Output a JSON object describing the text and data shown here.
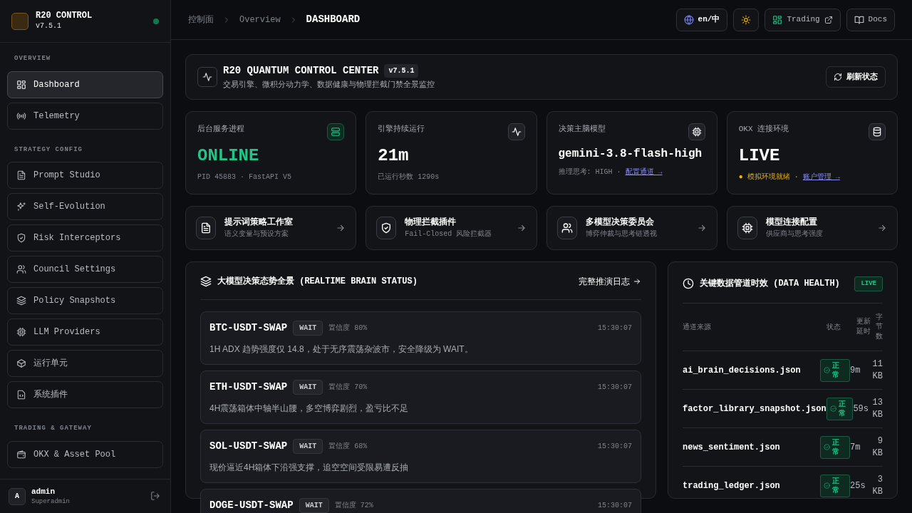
{
  "brand": {
    "title": "R20 CONTROL",
    "version": "v7.5.1",
    "online": true
  },
  "sidebar": {
    "sections": [
      {
        "heading": "OVERVIEW",
        "items": [
          {
            "label": "Dashboard",
            "selected": true
          },
          {
            "label": "Telemetry",
            "selected": false
          }
        ]
      },
      {
        "heading": "STRATEGY CONFIG",
        "items": [
          {
            "label": "Prompt Studio",
            "selected": false
          },
          {
            "label": "Self-Evolution",
            "selected": false
          },
          {
            "label": "Risk Interceptors",
            "selected": false
          },
          {
            "label": "Council Settings",
            "selected": false
          },
          {
            "label": "Policy Snapshots",
            "selected": false
          },
          {
            "label": "LLM Providers",
            "selected": false
          },
          {
            "label": "运行单元",
            "selected": false
          },
          {
            "label": "系统插件",
            "selected": false
          }
        ]
      },
      {
        "heading": "TRADING & GATEWAY",
        "items": [
          {
            "label": "OKX & Asset Pool",
            "selected": false
          }
        ]
      }
    ]
  },
  "user": {
    "avatar": "A",
    "name": "admin",
    "role": "Superadmin"
  },
  "breadcrumb": [
    "控制面",
    "Overview",
    "DASHBOARD"
  ],
  "toolbar": {
    "language": "en/中",
    "trading": "Trading",
    "docs": "Docs"
  },
  "hero": {
    "title": "R20 QUANTUM CONTROL CENTER",
    "version": "v7.5.1",
    "subtitle": "交易引擎、微积分动力学、数据健康与物理拦截门禁全景监控",
    "button": "刷新状态"
  },
  "stats": [
    {
      "label": "后台服务进程",
      "value": "ONLINE",
      "highlighted": true,
      "note": "PID 45883 · FastAPI V5"
    },
    {
      "label": "引擎持续运行",
      "value": "21m",
      "highlighted": false,
      "note": "已运行秒数 1290s"
    },
    {
      "label": "决策主脑模型",
      "value": "gemini-3.8-flash-high",
      "highlighted": false,
      "note": "推理思考: HIGH ·",
      "link": "配置通道 →"
    },
    {
      "label": "OKX 连接环境",
      "value": "LIVE",
      "highlighted": false,
      "status": "● 模拟环境就绪 ·",
      "link": "账户管理 →"
    }
  ],
  "shortcuts": [
    {
      "title": "提示词策略工作室",
      "subtitle": "语义变量与预设方案"
    },
    {
      "title": "物理拦截插件",
      "subtitle": "Fail-Closed 风险拦截器"
    },
    {
      "title": "多模型决策委员会",
      "subtitle": "博弈仲裁与思考链透视"
    },
    {
      "title": "模型连接配置",
      "subtitle": "供应商与思考强度"
    }
  ],
  "brain": {
    "title": "大模型决策态势全景 (REALTIME BRAIN STATUS)",
    "link": "完整推演日志",
    "decisions": [
      {
        "symbol": "BTC-USDT-SWAP",
        "action": "WAIT",
        "confidence": "置信度 80%",
        "time": "15:30:07",
        "reason": "1H ADX 趋势强度仅 14.8，处于无序震荡杂波市，安全降级为 WAIT。"
      },
      {
        "symbol": "ETH-USDT-SWAP",
        "action": "WAIT",
        "confidence": "置信度 70%",
        "time": "15:30:07",
        "reason": "4H震荡箱体中轴半山腰，多空博弈剧烈，盈亏比不足"
      },
      {
        "symbol": "SOL-USDT-SWAP",
        "action": "WAIT",
        "confidence": "置信度 68%",
        "time": "15:30:07",
        "reason": "现价逼近4H箱体下沿强支撑，追空空间受限易遭反抽"
      },
      {
        "symbol": "DOGE-USDT-SWAP",
        "action": "WAIT",
        "confidence": "置信度 72%",
        "time": "15:30:07"
      }
    ]
  },
  "health": {
    "title": "关键数据管道时效 (DATA HEALTH)",
    "badge": "LIVE",
    "columns": [
      "通道来源",
      "状态",
      "更新延时",
      "字节数"
    ],
    "rows": [
      {
        "source": "ai_brain_decisions.json",
        "status": "正常",
        "ok": true,
        "delay": "9m",
        "size": "11 KB"
      },
      {
        "source": "factor_library_snapshot.json",
        "status": "正常",
        "ok": true,
        "delay": "59s",
        "size": "13 KB"
      },
      {
        "source": "news_sentiment.json",
        "status": "正常",
        "ok": true,
        "delay": "7m",
        "size": "9 KB"
      },
      {
        "source": "trading_ledger.json",
        "status": "正常",
        "ok": true,
        "delay": "25s",
        "size": "3 KB"
      }
    ]
  }
}
